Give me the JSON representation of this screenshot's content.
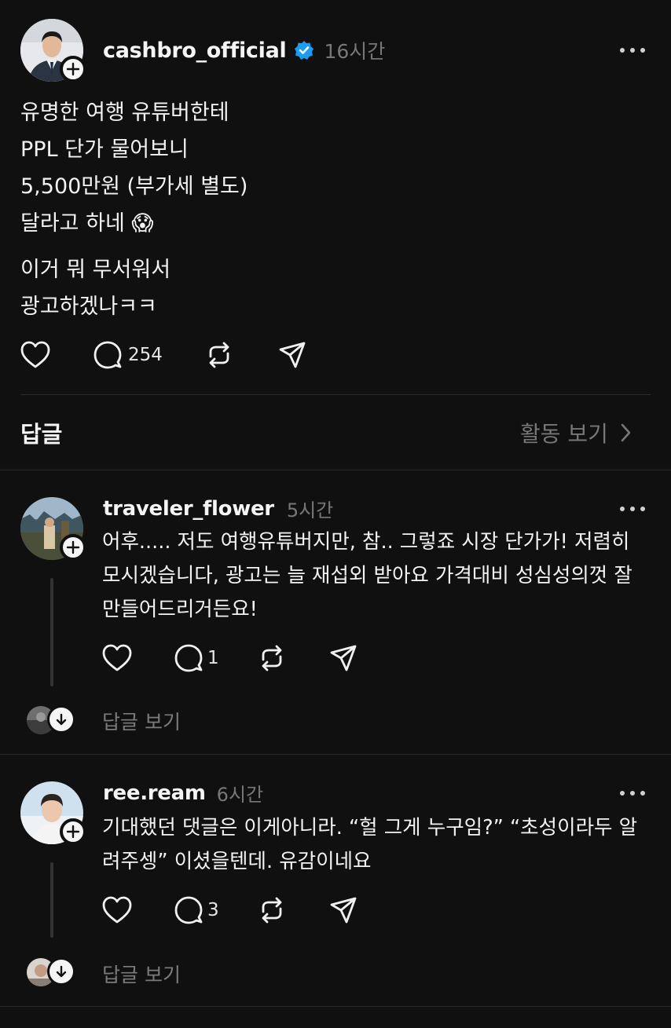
{
  "post": {
    "username": "cashbro_official",
    "time": "16시간",
    "verified": true,
    "lines": [
      "유명한 여행 유튜버한테",
      "PPL 단가 물어보니",
      "5,500만원 (부가세 별도)",
      "달라고 하네 😱",
      "이거 뭐 무서워서",
      "광고하겠나ㅋㅋ"
    ],
    "comment_count": "254"
  },
  "replies_header": {
    "title": "답글",
    "activity_label": "활동 보기"
  },
  "replies": [
    {
      "username": "traveler_flower",
      "time": "5시간",
      "text": "어후..... 저도 여행유튜버지만, 참.. 그렇죠 시장 단가가! 저렴히 모시겠습니다, 광고는 늘 재섭외 받아요 가격대비 성심성의껏 잘 만들어드리거든요!",
      "comment_count": "1",
      "see_replies": "답글 보기"
    },
    {
      "username": "ree.ream",
      "time": "6시간",
      "text": "기대했던 댓글은 이게아니라. “헐 그게 누구임?” “초성이라두 알려주셍” 이셨을텐데. 유감이네요",
      "comment_count": "3",
      "see_replies": "답글 보기"
    }
  ],
  "colors": {
    "background": "#101010",
    "verified_badge": "#1d9bf0",
    "muted_text": "#777777"
  }
}
